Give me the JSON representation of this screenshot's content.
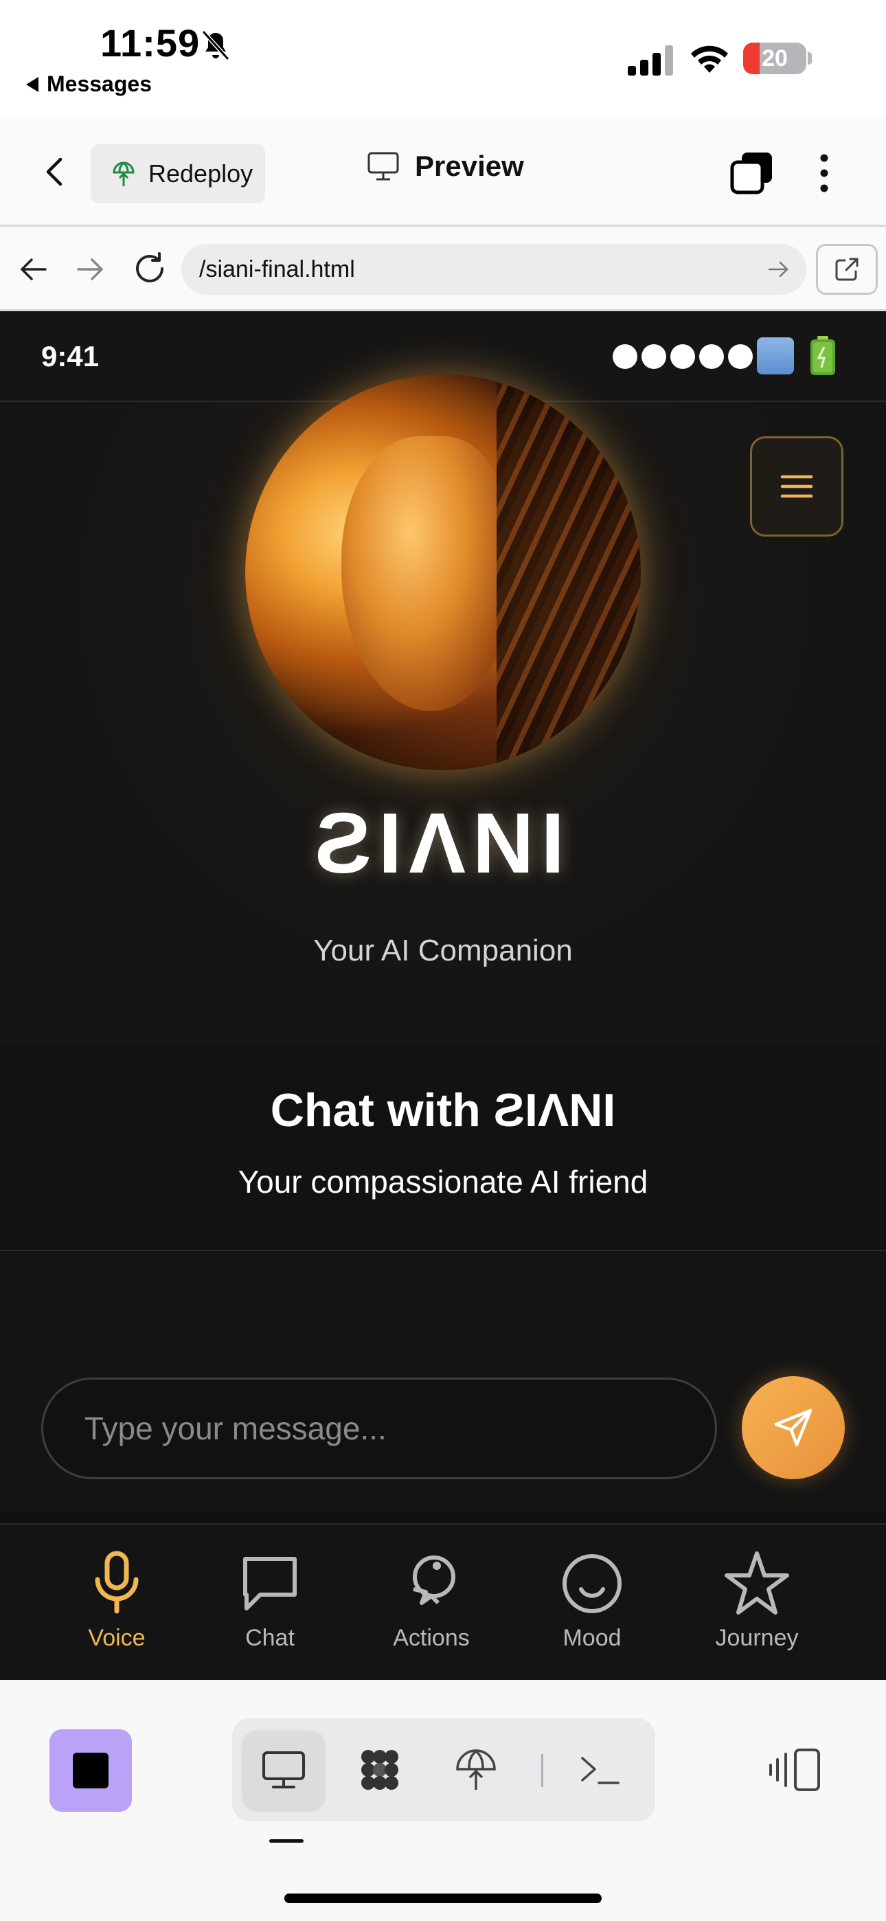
{
  "ios_status": {
    "time": "11:59",
    "back_app_label": "Messages",
    "battery_level": "20",
    "battery_color": "#ef3b30",
    "icons": [
      "bell-slash-icon",
      "cellular-signal-icon",
      "wifi-icon",
      "battery-icon"
    ]
  },
  "toolbar": {
    "redeploy_label": "Redeploy",
    "title": "Preview",
    "icons": [
      "back-chevron-icon",
      "globe-deploy-icon",
      "monitor-icon",
      "tabs-icon",
      "more-vertical-icon"
    ]
  },
  "browser": {
    "url": "/siani-final.html",
    "icons": [
      "arrow-left-icon",
      "arrow-right-icon",
      "reload-icon",
      "go-arrow-icon",
      "external-link-icon"
    ]
  },
  "app": {
    "status_time": "9:41",
    "status_dots": "●●●●●",
    "brand_name": "ƧIΛNI",
    "tagline": "Your AI Companion",
    "chat_title": "Chat with ƧIΛNI",
    "chat_subtitle": "Your compassionate AI friend",
    "input_placeholder": "Type your message...",
    "accent_color": "#f0b650",
    "tabs": [
      {
        "label": "Voice",
        "icon": "microphone-icon",
        "active": true
      },
      {
        "label": "Chat",
        "icon": "chat-bubble-icon",
        "active": false
      },
      {
        "label": "Actions",
        "icon": "actions-icon",
        "active": false
      },
      {
        "label": "Mood",
        "icon": "smile-icon",
        "active": false
      },
      {
        "label": "Journey",
        "icon": "star-icon",
        "active": false
      }
    ]
  },
  "dock": {
    "items": [
      "stop-icon",
      "monitor-icon",
      "apps-grid-icon",
      "deploy-icon",
      "terminal-icon",
      "layout-toggle-icon"
    ],
    "active_item": "monitor-icon",
    "stop_color": "#b9a2f7"
  }
}
